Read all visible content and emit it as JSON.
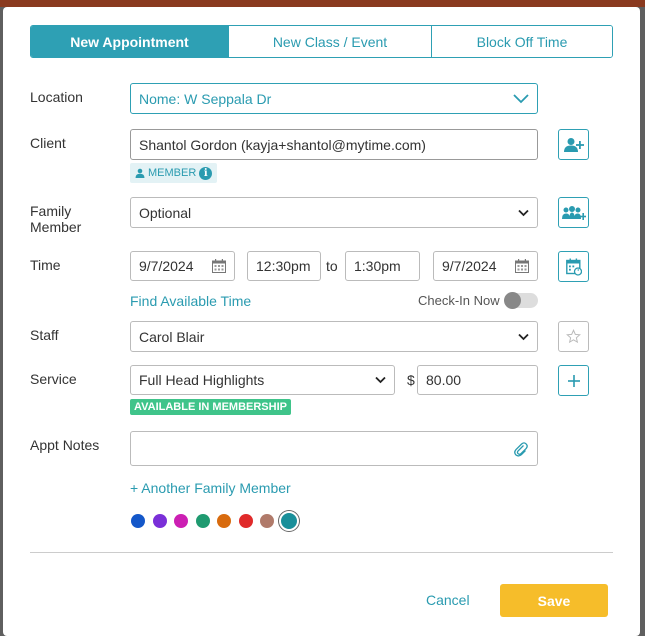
{
  "tabs": [
    {
      "label": "New Appointment",
      "active": true
    },
    {
      "label": "New Class / Event",
      "active": false
    },
    {
      "label": "Block Off Time",
      "active": false
    }
  ],
  "location": {
    "label": "Location",
    "value": "Nome: W Seppala Dr"
  },
  "client": {
    "label": "Client",
    "value": "Shantol Gordon (kayja+shantol@mytime.com)",
    "badge": "MEMBER",
    "add_icon": "add-user-icon"
  },
  "family": {
    "label_line1": "Family",
    "label_line2": "Member",
    "value": "Optional",
    "add_icon": "add-family-icon"
  },
  "time": {
    "label": "Time",
    "start_date": "9/7/2024",
    "start_time": "12:30pm",
    "to": "to",
    "end_time": "1:30pm",
    "end_date": "9/7/2024",
    "find_available": "Find Available Time",
    "checkin_label": "Check-In Now",
    "checkin_on": false,
    "recurring_icon": "recurring-calendar-icon"
  },
  "staff": {
    "label": "Staff",
    "value": "Carol Blair",
    "fav_icon": "star-icon"
  },
  "service": {
    "label": "Service",
    "value": "Full Head Highlights",
    "currency": "$",
    "price": "80.00",
    "badge": "AVAILABLE IN MEMBERSHIP",
    "add_icon": "plus-icon"
  },
  "notes": {
    "label": "Appt Notes",
    "value": "",
    "attach_icon": "paperclip-icon",
    "add_family_link": "+ Another Family Member"
  },
  "colors": [
    "#1457c9",
    "#7a2fd8",
    "#cc1fb3",
    "#1f9a70",
    "#d86b0e",
    "#e02a2a",
    "#b07a6a",
    "#1a8f9a"
  ],
  "selected_color_index": 7,
  "footer": {
    "cancel": "Cancel",
    "save": "Save"
  },
  "theme": {
    "accent": "#2ea0b4",
    "save": "#f6bd2a",
    "badge_green": "#3fc48a"
  }
}
